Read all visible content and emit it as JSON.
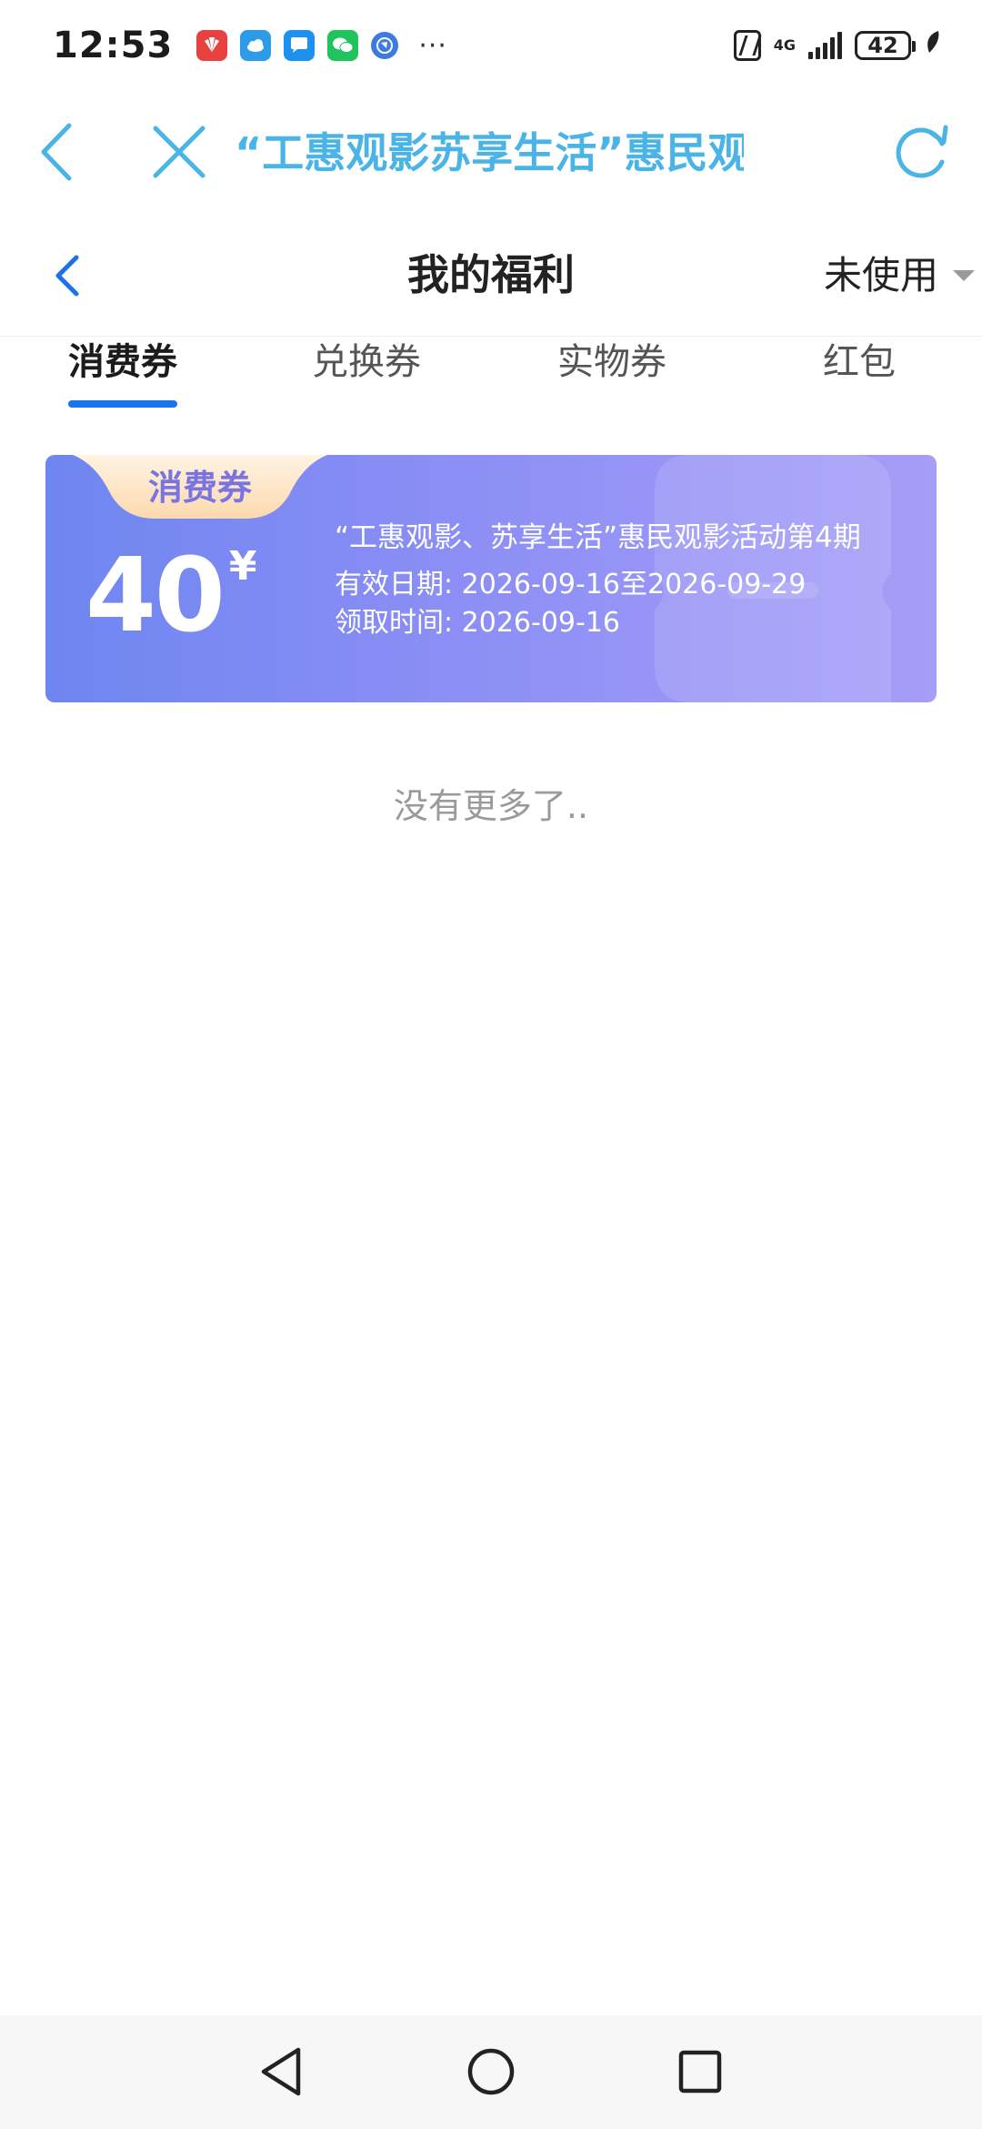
{
  "status_bar": {
    "time": "12:53",
    "network": "4G",
    "battery": "42",
    "more": "···"
  },
  "browser": {
    "page_title": "“工惠观影苏享生活”惠民观影活动"
  },
  "header": {
    "title": "我的福利",
    "filter_label": "未使用"
  },
  "tabs": [
    {
      "label": "消费券",
      "active": true
    },
    {
      "label": "兑换券",
      "active": false
    },
    {
      "label": "实物券",
      "active": false
    },
    {
      "label": "红包",
      "active": false
    }
  ],
  "coupons": [
    {
      "tag": "消费券",
      "amount": "40",
      "currency": "¥",
      "title": "“工惠观影、苏享生活”惠民观影活动第4期",
      "validity_label": "有效日期:",
      "validity_value": "2026-09-16至2026-09-29",
      "received_label": "领取时间:",
      "received_value": "2026-09-16"
    }
  ],
  "empty_hint": "没有更多了..",
  "colors": {
    "accent_blue": "#1a73e8",
    "browser_blue": "#4ab4e6",
    "coupon_start": "#6e86f0",
    "coupon_end": "#a69df7",
    "tag_bg": "#fde4c4",
    "tag_text": "#7a74e0"
  }
}
